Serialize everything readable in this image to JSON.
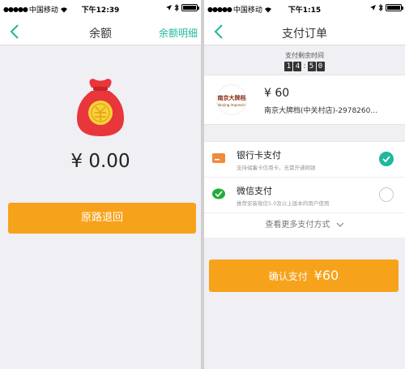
{
  "status_left": {
    "signal": "●●●●●",
    "carrier": "中国移动",
    "time": "下午12:39"
  },
  "status_right": {
    "signal": "●●●●●",
    "carrier": "中国移动",
    "time": "下午1:15"
  },
  "balance_screen": {
    "title": "余额",
    "right_link": "余额明细",
    "amount": "¥ 0.00",
    "refund_button": "原路退回"
  },
  "order_screen": {
    "title": "支付订单",
    "timer_label": "支付剩余时间",
    "timer_digits": [
      "1",
      "4",
      "5",
      "0"
    ],
    "timer_colon": ":",
    "merchant": {
      "logo_text": "南京大牌档",
      "logo_subtext": "Nanjing Impressions",
      "amount": "¥ 60",
      "name": "南京大牌档(中关村店)-2978260..."
    },
    "payment_methods": [
      {
        "name": "银行卡支付",
        "desc": "支持储蓄卡信用卡，无需开通网银",
        "icon": "bank-card-icon",
        "selected": true
      },
      {
        "name": "微信支付",
        "desc": "推荐安装微信5.0及以上版本的用户使用",
        "icon": "wechat-pay-icon",
        "selected": false
      }
    ],
    "more_methods": "查看更多支付方式",
    "confirm_label": "确认支付",
    "confirm_amount": "¥60"
  },
  "colors": {
    "accent": "#1eb89c",
    "button": "#f7a21b",
    "bag": "#e8363a"
  }
}
